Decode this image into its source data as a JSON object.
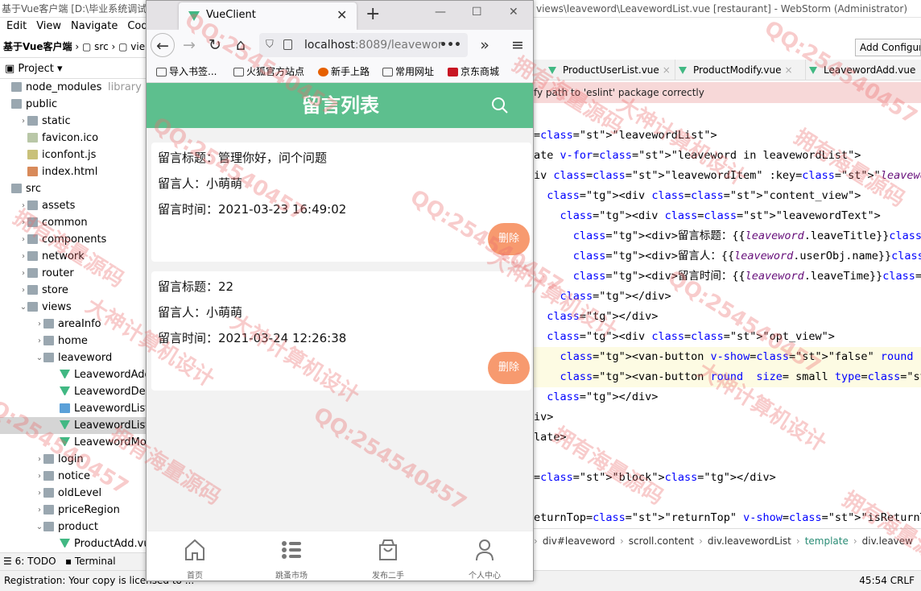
{
  "ide": {
    "title_left": "基于Vue客户端 [D:\\毕业系统调试区",
    "title_right": "views\\leaveword\\LeavewordList.vue [restaurant] - WebStorm (Administrator)",
    "menu": [
      "Edit",
      "View",
      "Navigate",
      "Code"
    ],
    "crumbs": {
      "project": "基于Vue客户端",
      "src": "src",
      "views": "vie"
    },
    "project_label": "Project",
    "add_config": "Add Configur",
    "tree": [
      {
        "label": "node_modules",
        "extra": "library root",
        "level": 0,
        "kind": "folder",
        "arrow": ""
      },
      {
        "label": "public",
        "level": 0,
        "kind": "folder",
        "arrow": ""
      },
      {
        "label": "static",
        "level": 1,
        "kind": "folder",
        "arrow": "›"
      },
      {
        "label": "favicon.ico",
        "level": 1,
        "kind": "file",
        "arrow": ""
      },
      {
        "label": "iconfont.js",
        "level": 1,
        "kind": "js",
        "arrow": ""
      },
      {
        "label": "index.html",
        "level": 1,
        "kind": "html",
        "arrow": ""
      },
      {
        "label": "src",
        "level": 0,
        "kind": "folder",
        "arrow": ""
      },
      {
        "label": "assets",
        "level": 1,
        "kind": "folder",
        "arrow": "›"
      },
      {
        "label": "common",
        "level": 1,
        "kind": "folder",
        "arrow": "›"
      },
      {
        "label": "components",
        "level": 1,
        "kind": "folder",
        "arrow": "›"
      },
      {
        "label": "network",
        "level": 1,
        "kind": "folder",
        "arrow": "›"
      },
      {
        "label": "router",
        "level": 1,
        "kind": "folder",
        "arrow": "›"
      },
      {
        "label": "store",
        "level": 1,
        "kind": "folder",
        "arrow": "›"
      },
      {
        "label": "views",
        "level": 1,
        "kind": "folder",
        "arrow": "⌄"
      },
      {
        "label": "areaInfo",
        "level": 2,
        "kind": "folder",
        "arrow": "›"
      },
      {
        "label": "home",
        "level": 2,
        "kind": "folder",
        "arrow": "›"
      },
      {
        "label": "leaveword",
        "level": 2,
        "kind": "folder",
        "arrow": "⌄"
      },
      {
        "label": "LeavewordAdd.vue",
        "level": 3,
        "kind": "vue",
        "arrow": ""
      },
      {
        "label": "LeavewordDetail.vue",
        "level": 3,
        "kind": "vue",
        "arrow": ""
      },
      {
        "label": "LeavewordList.css",
        "level": 3,
        "kind": "css",
        "arrow": ""
      },
      {
        "label": "LeavewordList.vue",
        "level": 3,
        "kind": "vue",
        "arrow": "",
        "selected": true
      },
      {
        "label": "LeavewordModify.vue",
        "level": 3,
        "kind": "vue",
        "arrow": ""
      },
      {
        "label": "login",
        "level": 2,
        "kind": "folder",
        "arrow": "›"
      },
      {
        "label": "notice",
        "level": 2,
        "kind": "folder",
        "arrow": "›"
      },
      {
        "label": "oldLevel",
        "level": 2,
        "kind": "folder",
        "arrow": "›"
      },
      {
        "label": "priceRegion",
        "level": 2,
        "kind": "folder",
        "arrow": "›"
      },
      {
        "label": "product",
        "level": 2,
        "kind": "folder",
        "arrow": "⌄"
      },
      {
        "label": "ProductAdd.vue",
        "level": 3,
        "kind": "vue",
        "arrow": ""
      }
    ],
    "editor_tabs": [
      "ProductUserList.vue",
      "ProductModify.vue",
      "LeavewordAdd.vue"
    ],
    "lint_message": "fy path to 'eslint' package correctly",
    "code_lines": [
      "=\"leavewordList\">",
      "ate v-for=\"leaveword in leavewordList\">",
      "iv class=\"leavewordItem\" :key=\"leaveword.leaveWordId\" @click.",
      "  <div class=\"content_view\">",
      "    <div class=\"leavewordText\">",
      "      <div>留言标题：{{leaveword.leaveTitle}}</div>",
      "      <div>留言人：{{leaveword.userObj.name}}</div>",
      "      <div>留言时间：{{leaveword.leaveTime}}</div>",
      "    </div>",
      "  </div>",
      "  <div class=\"opt_view\">",
      "    <van-button v-show=\"false\" round  size= small type=\"pri",
      "    <van-button round  size= small type=\"warning\" @click.st",
      "  </div>",
      "iv>",
      "late>",
      "",
      "=\"block\"></div>",
      "",
      "eturnTop=\"returnTop\" v-show=\"isReturnTop\"></return-top>"
    ],
    "editor_crumbs": [
      "div#leaveword",
      "scroll.content",
      "div.leavewordList",
      "template",
      "div.leavew"
    ],
    "bottom_tools": [
      "6: TODO",
      "Terminal"
    ],
    "status_left": "Registration: Your copy is licensed to ...",
    "status_right": "45:54  CRLF"
  },
  "browser": {
    "tab_title": "VueClient",
    "url_host": "localhost",
    "url_rest": ":8089/leavewor",
    "bookmarks": [
      "导入书签...",
      "火狐官方站点",
      "新手上路",
      "常用网址",
      "京东商城"
    ],
    "app": {
      "title": "留言列表",
      "delete_label": "删除",
      "items": [
        {
          "title": "留言标题：管理你好，问个问题",
          "author": "留言人：小萌萌",
          "time": "留言时间：2021-03-23 16:49:02"
        },
        {
          "title": "留言标题：22",
          "author": "留言人：小萌萌",
          "time": "留言时间：2021-03-24 12:26:38"
        }
      ],
      "tabbar": [
        "首页",
        "跳蚤市场",
        "发布二手",
        "个人中心"
      ]
    }
  },
  "watermark": [
    "拥有海量源码",
    "QQ:254540457",
    "大神计算机设计"
  ]
}
